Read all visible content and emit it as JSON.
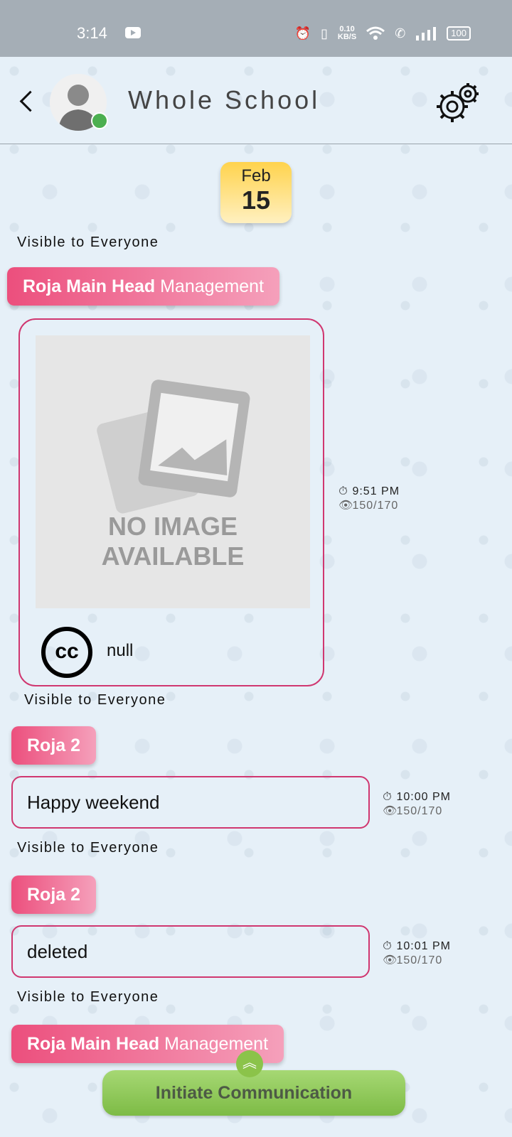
{
  "status_bar": {
    "time": "3:14",
    "net_speed_top": "0.10",
    "net_speed_bottom": "KB/S",
    "battery": "100"
  },
  "header": {
    "title": "Whole School"
  },
  "date": {
    "month": "Feb",
    "day": "15"
  },
  "messages": [
    {
      "visibility": "Visible to Everyone",
      "sender_name": "Roja Main Head",
      "sender_role": "Management",
      "type": "image",
      "image_text_line1": "NO IMAGE",
      "image_text_line2": "AVAILABLE",
      "cc_label": "cc",
      "caption": "null",
      "time": "9:51 PM",
      "views": "150/170"
    },
    {
      "visibility": "Visible to Everyone",
      "sender_name": "Roja 2",
      "type": "text",
      "text": "Happy weekend",
      "time": "10:00 PM",
      "views": "150/170"
    },
    {
      "visibility": "Visible to Everyone",
      "sender_name": "Roja 2",
      "type": "text",
      "text": "deleted",
      "time": "10:01 PM",
      "views": "150/170"
    },
    {
      "visibility": "Visible to Everyone",
      "sender_name": "Roja Main Head",
      "sender_role": "Management"
    }
  ],
  "icons": {
    "back": "back-arrow-icon",
    "settings": "gear-icon",
    "timer": "stopwatch-icon",
    "views": "eye-icon",
    "scroll_up": "double-chevron-up-icon"
  },
  "colors": {
    "accent_pink": "#d03770",
    "tag_gradient_start": "#ec4f7d",
    "tag_gradient_end": "#f5a0bb",
    "online_green": "#4caf50",
    "button_green": "#8bc34a",
    "date_yellow": "#ffd34d"
  },
  "footer": {
    "initiate_label": "Initiate Communication",
    "scroll_up_glyph": "︽"
  }
}
